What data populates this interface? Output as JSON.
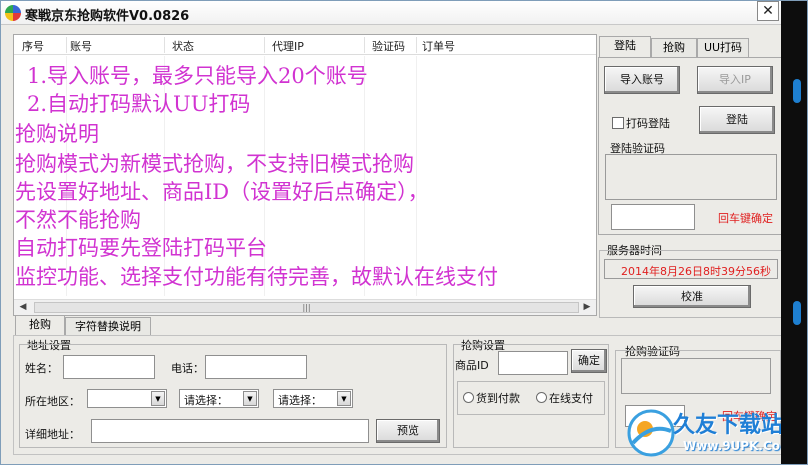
{
  "window": {
    "title": "寒戦京东抢购软件V0.0826",
    "close_glyph": "✕"
  },
  "list": {
    "columns": [
      "序号",
      "账号",
      "状态",
      "代理IP",
      "验证码",
      "订单号"
    ],
    "scroll_thumb": "|||"
  },
  "overlay_lines": [
    "1.导入账号，最多只能导入20个账号",
    "2.自动打码默认UU打码",
    "抢购说明",
    "抢购模式为新模式抢购，不支持旧模式抢购",
    "先设置好地址、商品ID（设置好后点确定），",
    "不然不能抢购",
    "自动打码要先登陆打码平台",
    "监控功能、选择支付功能有待完善，故默认在线支付"
  ],
  "right_tabs": [
    "登陆",
    "抢购",
    "UU打码"
  ],
  "login_panel": {
    "import_account": "导入账号",
    "import_ip": "导入IP",
    "captcha_login_label": "打码登陆",
    "login_button": "登陆",
    "login_captcha_label": "登陆验证码",
    "enter_confirm": "回车键确定"
  },
  "server_time": {
    "group_label": "服务器时间",
    "value": "2014年8月26日8时39分56秒",
    "calibrate_button": "校准"
  },
  "bottom_tabs": [
    "抢购",
    "字符替换说明"
  ],
  "address": {
    "group_label": "地址设置",
    "name_label": "姓名：",
    "name_value": "",
    "phone_label": "电话：",
    "phone_value": "",
    "region_label": "所在地区：",
    "select_placeholder_1": "请选择：",
    "select_placeholder_2": "请选择：",
    "detail_label": "详细地址：",
    "detail_value": "",
    "preview_button": "预览"
  },
  "purchase": {
    "group_label": "抢购设置",
    "product_id_label": "商品ID",
    "product_id_value": "",
    "confirm_button": "确定",
    "pay_on_delivery": "货到付款",
    "pay_online": "在线支付"
  },
  "purchase_captcha": {
    "label": "抢购验证码",
    "hint": "回车键确定"
  },
  "watermark": {
    "brand": "久友下载站",
    "url": "Www.9UPK.Com"
  },
  "colors": {
    "overlay_text": "#d133d1",
    "accent_red": "#e02020",
    "title_bg": "#ffffff"
  }
}
